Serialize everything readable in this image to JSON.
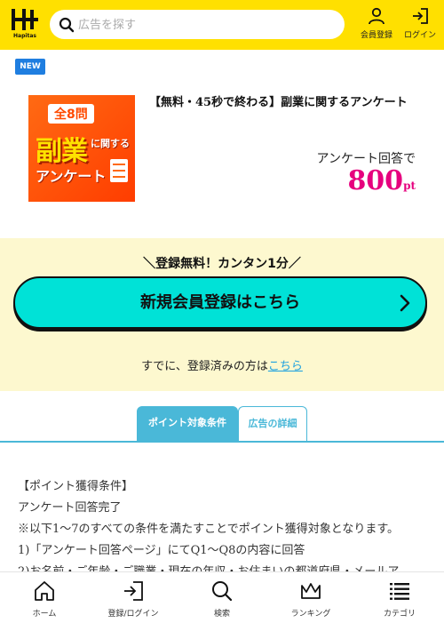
{
  "header": {
    "logo_text": "Hapitas",
    "search_placeholder": "広告を探す",
    "member_label": "会員登録",
    "login_label": "ログイン"
  },
  "ad": {
    "badge": "NEW",
    "banner": {
      "line1": "全8問",
      "line2": "副業",
      "line3": "に関する",
      "line4": "アンケート"
    },
    "title": "【無料・45秒で終わる】副業に関するアンケート",
    "reward_label": "アンケート回答で",
    "reward_value": "800",
    "reward_unit": "pt"
  },
  "registration": {
    "lead": "＼登録無料！カンタン1分／",
    "button_label": "新規会員登録はこちら",
    "already_text": "すでに、登録済みの方は",
    "already_link": "こちら"
  },
  "tabs": [
    {
      "label": "ポイント対象条件",
      "active": true
    },
    {
      "label": "広告の詳細",
      "active": false
    }
  ],
  "conditions": {
    "lines": [
      "【ポイント獲得条件】",
      "アンケート回答完了",
      "※以下1〜7のすべての条件を満たすことでポイント獲得対象となります。",
      "1)「アンケート回答ページ」にてQ1～Q8の内容に回答",
      "2)お名前・ご年齢・ご職業・現在の年収・お住まいの都道府県・メールア"
    ]
  },
  "bottom_nav": [
    {
      "label": "ホーム",
      "icon": "home-icon"
    },
    {
      "label": "登録/ログイン",
      "icon": "login-icon"
    },
    {
      "label": "検索",
      "icon": "search-icon"
    },
    {
      "label": "ランキング",
      "icon": "crown-icon"
    },
    {
      "label": "カテゴリ",
      "icon": "menu-icon"
    }
  ],
  "colors": {
    "header_bg": "#ffe000",
    "accent_cyan": "#00e2d7",
    "tab_blue": "#4ab8d8",
    "point_pink": "#e6007e",
    "badge_blue": "#1f7ee0"
  }
}
